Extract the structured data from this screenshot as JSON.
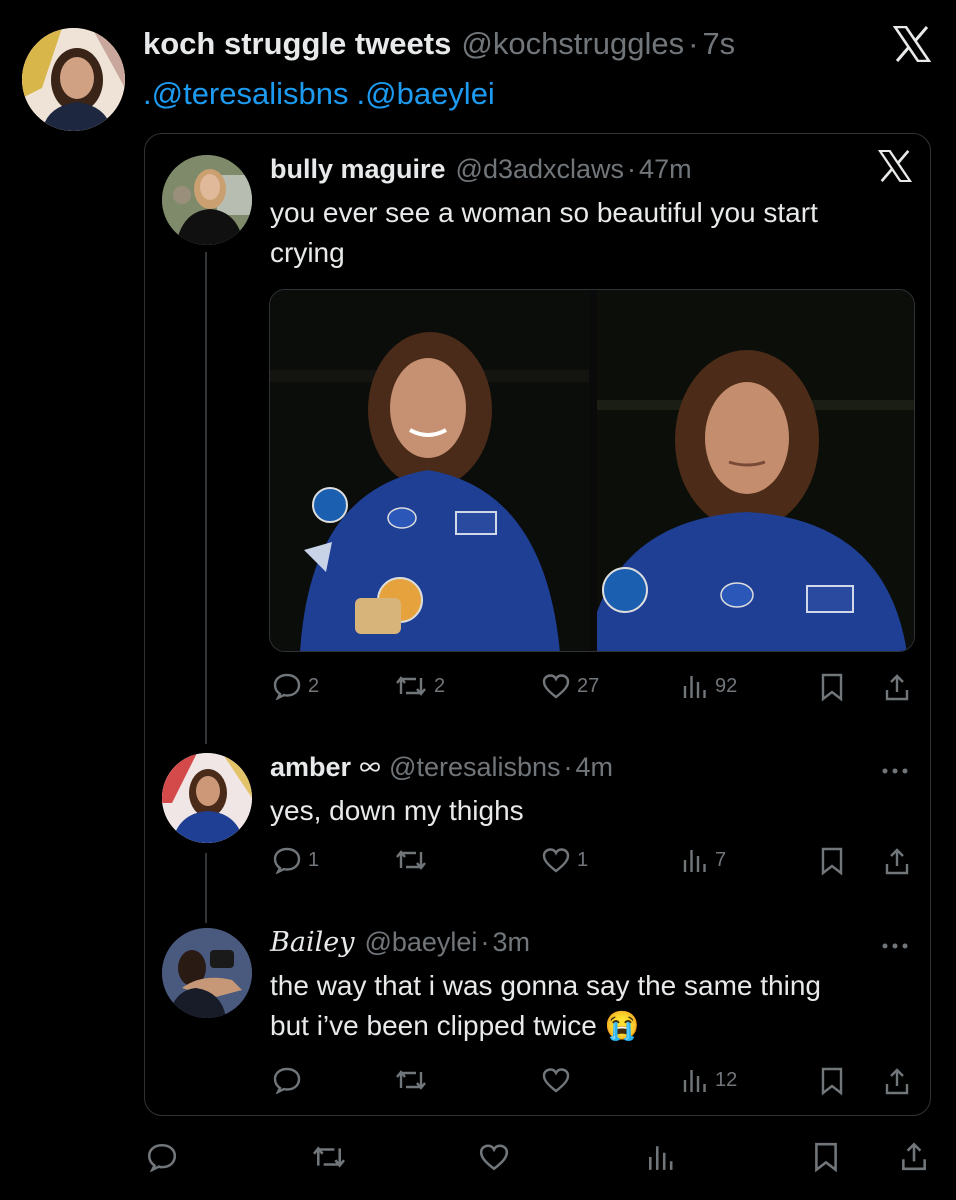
{
  "main_tweet": {
    "display_name": "koch struggle tweets",
    "handle": "@kochstruggles",
    "time": "7s",
    "mentions": [
      ".@teresalisbns",
      ".@baeylei"
    ]
  },
  "quoted": {
    "display_name": "bully maguire",
    "handle": "@d3adxclaws",
    "time": "47m",
    "text_line1": "you ever see a woman so beautiful you start",
    "text_line2": "crying",
    "stats": {
      "replies": "2",
      "reposts": "2",
      "likes": "27",
      "views": "92"
    }
  },
  "reply1": {
    "display_name": "amber",
    "handle": "@teresalisbns",
    "time": "4m",
    "text": "yes, down my thighs",
    "stats": {
      "replies": "1",
      "reposts": "",
      "likes": "1",
      "views": "7"
    }
  },
  "reply2": {
    "display_name": "Bailey",
    "handle": "@baeylei",
    "time": "3m",
    "text_line1": "the way that i was gonna say the same thing",
    "text_line2": "but i’ve been clipped twice",
    "emoji": "😭",
    "stats": {
      "replies": "",
      "reposts": "",
      "likes": "",
      "views": "12"
    }
  },
  "separator": "·",
  "colors": {
    "background": "#000000",
    "text": "#e7e9ea",
    "muted": "#71767b",
    "link": "#1d9bf0",
    "border": "#2f3336",
    "suit_blue": "#1f3f94"
  }
}
